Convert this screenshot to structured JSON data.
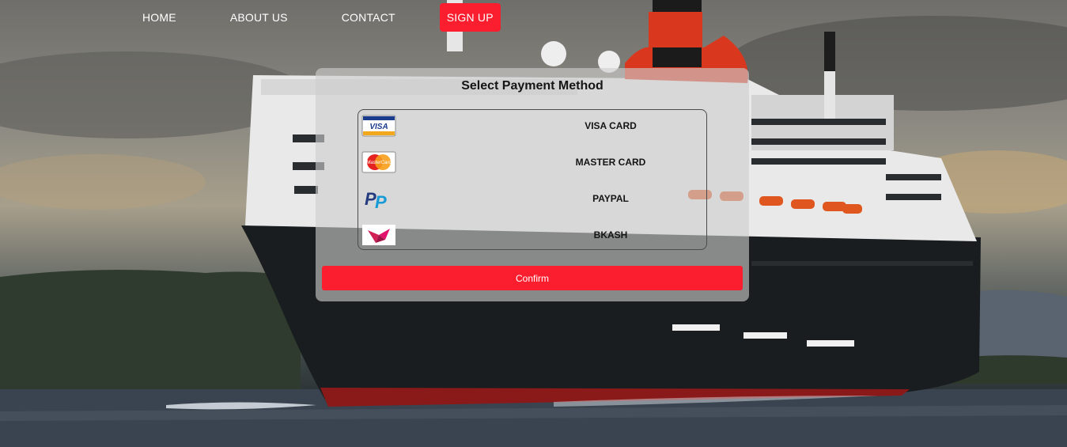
{
  "nav": {
    "home": "HOME",
    "about": "ABOUT US",
    "contact": "CONTACT",
    "signup": "SIGN UP"
  },
  "payment": {
    "title": "Select Payment Method",
    "methods": [
      {
        "label": "VISA CARD",
        "icon": "visa-logo",
        "logo_text": "VISA"
      },
      {
        "label": "MASTER CARD",
        "icon": "mastercard-logo",
        "logo_text": "MasterCard"
      },
      {
        "label": "PAYPAL",
        "icon": "paypal-logo"
      },
      {
        "label": "BKASH",
        "icon": "bkash-logo"
      }
    ],
    "confirm_label": "Confirm"
  },
  "colors": {
    "accent": "#fb1e2e",
    "panel": "rgba(205,205,205,0.62)",
    "text": "#151515"
  }
}
